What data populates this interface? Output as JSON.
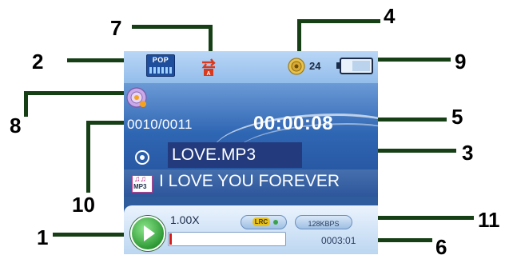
{
  "callouts": {
    "n1": "1",
    "n2": "2",
    "n3": "3",
    "n4": "4",
    "n5": "5",
    "n6": "6",
    "n7": "7",
    "n8": "8",
    "n9": "9",
    "n10": "10",
    "n11": "11"
  },
  "status_bar": {
    "eq_mode": "POP",
    "repeat_icon": "repeat-all-icon",
    "volume_icon": "speaker-icon",
    "volume_level": "24",
    "battery_icon": "battery-icon"
  },
  "track": {
    "counter": "0010/0011",
    "elapsed": "00:00:08",
    "mode_icon": "play-mode-icon",
    "file_name": "LOVE.MP3",
    "lyric": "I LOVE YOU FOREVER",
    "file_type_icon_label": "MP3"
  },
  "bottom": {
    "play_icon": "play-icon",
    "speed": "1.00X",
    "lrc_label": "LRC",
    "bitrate": "128KBPS",
    "progress": 0.02,
    "total_time": "0003:01"
  },
  "colors": {
    "leader": "#163f16",
    "progress": "#d61b1b",
    "screen": "#2e5c9c"
  }
}
